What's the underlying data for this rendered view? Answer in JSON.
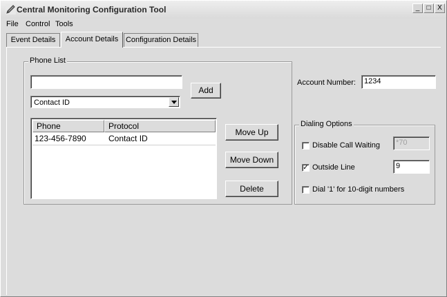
{
  "window": {
    "title": "Central Monitoring Configuration Tool",
    "controls": {
      "minimize": "_",
      "maximize": "□",
      "close": "X"
    }
  },
  "menu": [
    "File",
    "Control",
    "Tools"
  ],
  "tabs": [
    {
      "label": "Event Details",
      "active": false
    },
    {
      "label": "Account Details",
      "active": true
    },
    {
      "label": "Configuration Details",
      "active": false
    }
  ],
  "phone_list": {
    "group_title": "Phone List",
    "phone_input_value": "",
    "add_label": "Add",
    "protocol_selected": "Contact ID",
    "columns": [
      "Phone",
      "Protocol"
    ],
    "rows": [
      {
        "phone": "123-456-7890",
        "protocol": "Contact ID"
      }
    ],
    "move_up_label": "Move Up",
    "move_down_label": "Move Down",
    "delete_label": "Delete"
  },
  "account": {
    "label": "Account Number:",
    "value": "1234"
  },
  "dialing": {
    "group_title": "Dialing Options",
    "disable_call_waiting": {
      "label": "Disable Call Waiting",
      "checked": false,
      "value": "*70"
    },
    "outside_line": {
      "label": "Outside Line",
      "checked": true,
      "value": "9"
    },
    "dial_1": {
      "label": "Dial '1' for 10-digit numbers",
      "checked": false
    }
  }
}
